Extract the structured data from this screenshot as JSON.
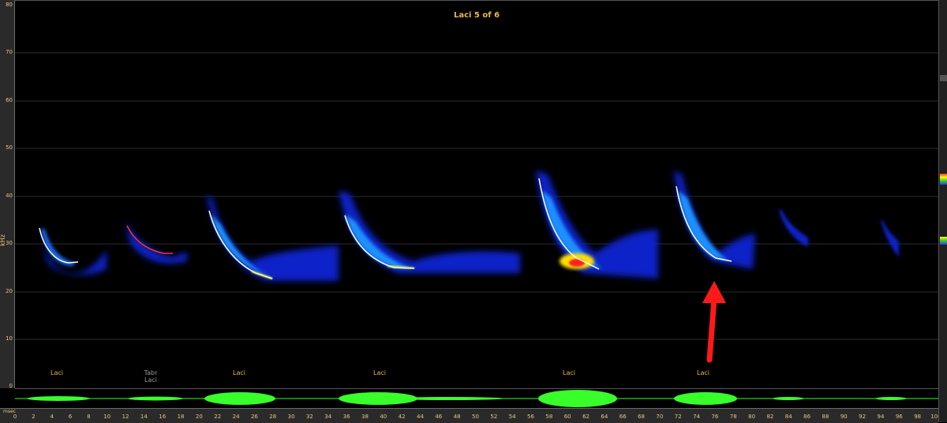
{
  "title": "Laci  5 of 6",
  "y_axis": {
    "label": "kHz",
    "ticks": [
      "80",
      "70",
      "60",
      "50",
      "40",
      "30",
      "20",
      "10",
      "0"
    ]
  },
  "x_axis": {
    "unit_label": "msec",
    "ticks": [
      "0",
      "2",
      "4",
      "6",
      "8",
      "10",
      "12",
      "14",
      "16",
      "18",
      "20",
      "22",
      "24",
      "26",
      "28",
      "30",
      "32",
      "34",
      "36",
      "38",
      "40",
      "42",
      "44",
      "46",
      "48",
      "50",
      "52",
      "54",
      "56",
      "58",
      "60",
      "62",
      "64",
      "66",
      "68",
      "70",
      "72",
      "74",
      "76",
      "78",
      "80",
      "82",
      "84",
      "86",
      "88",
      "90",
      "92",
      "94",
      "96",
      "98",
      "100"
    ]
  },
  "call_labels": [
    {
      "primary": "Laci",
      "secondary": ""
    },
    {
      "primary": "Tabr",
      "secondary": "Laci"
    },
    {
      "primary": "Laci",
      "secondary": ""
    },
    {
      "primary": "Laci",
      "secondary": ""
    },
    {
      "primary": "Laci",
      "secondary": ""
    },
    {
      "primary": "Laci",
      "secondary": ""
    }
  ],
  "colors": {
    "label_gold": "#e9b84a",
    "tick_gold": "#e6c57a",
    "alt_label_grey": "#9a9a9a",
    "call_trace_white": "#ffffff",
    "call_trace_red": "#ff3030",
    "waveform_green": "#38ff2a",
    "arrow_red": "#ff1a1a"
  },
  "annotation": {
    "type": "arrow",
    "icon": "red-arrow-icon",
    "direction": "up"
  }
}
